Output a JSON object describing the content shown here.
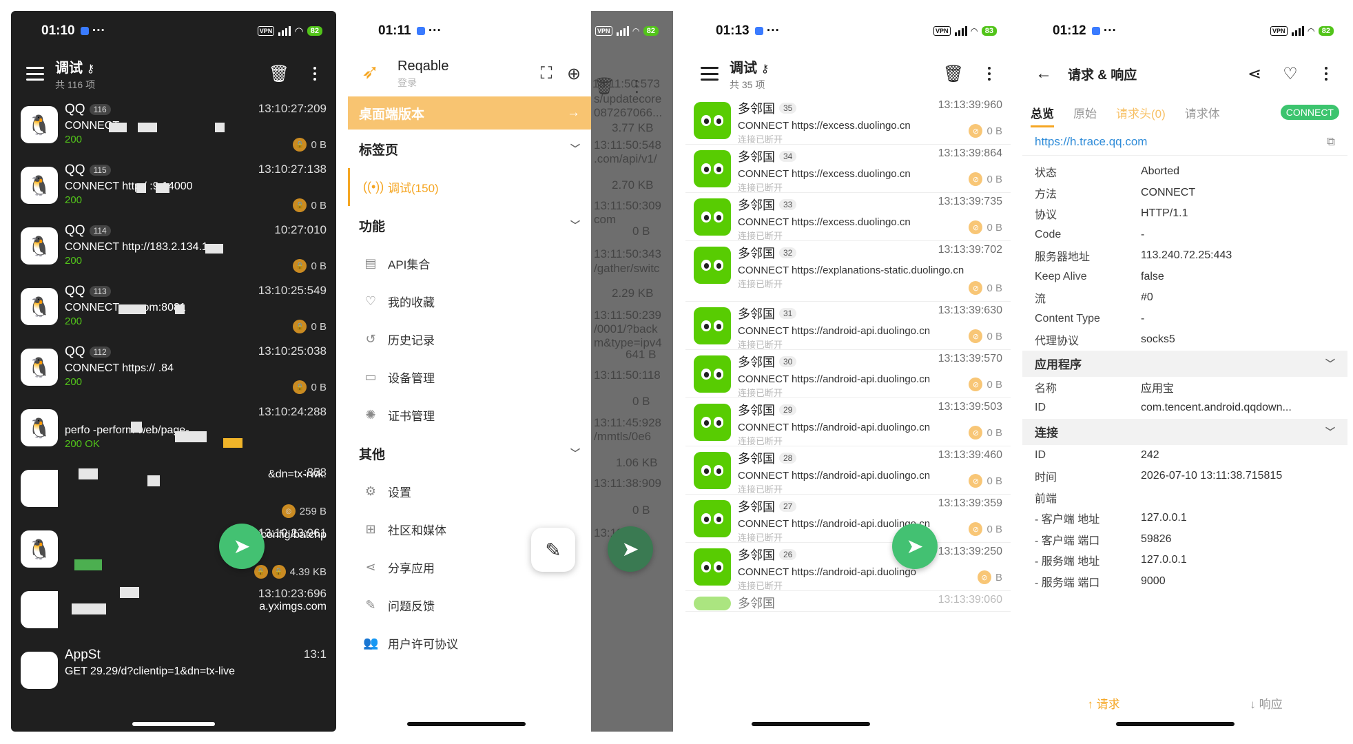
{
  "phone1": {
    "status_time": "01:10",
    "battery": "82",
    "title": "调试",
    "subtitle": "共 116 项",
    "rows": [
      {
        "name": "QQ",
        "badge": "116",
        "time": "13:10:27:209",
        "line": "CONNECT",
        "code": "200",
        "size": "0 B"
      },
      {
        "name": "QQ",
        "badge": "115",
        "time": "13:10:27:138",
        "line": "CONNECT http:/              :9:14000",
        "code": "200",
        "size": "0 B"
      },
      {
        "name": "QQ",
        "badge": "114",
        "time": "10:27:010",
        "line": "CONNECT http://183.2.134.1",
        "code": "200",
        "size": "0 B"
      },
      {
        "name": "QQ",
        "badge": "113",
        "time": "13:10:25:549",
        "line": "CONNECT               qq.com:8081",
        "code": "200",
        "size": "0 B"
      },
      {
        "name": "QQ",
        "badge": "112",
        "time": "13:10:25:038",
        "line": "CONNECT https://           .84",
        "code": "200",
        "size": "0 B"
      },
      {
        "name": "",
        "badge": "",
        "time": "13:10:24:288",
        "line": "perfo         -perform      web/page-",
        "code": "200 OK",
        "size": ""
      },
      {
        "name": "",
        "badge": "",
        "time": ":858",
        "line": "&dn=tx-rwk.",
        "code": "",
        "size": "259 B"
      },
      {
        "name": "",
        "badge": "",
        "time": "13:10:23:961",
        "line": "v3/config/batchp",
        "code": "",
        "size": "4.39 KB"
      },
      {
        "name": "",
        "badge": "",
        "time": "13:10:23:696",
        "line": "a.yximgs.com",
        "code": "",
        "size": ""
      },
      {
        "name": "AppSt",
        "badge": "",
        "time": "13:1",
        "line": "GET                29.29/d?clientip=1&dn=tx-live",
        "code": "",
        "size": ""
      }
    ]
  },
  "phone2": {
    "status_time": "01:11",
    "battery": "82",
    "app_name": "Reqable",
    "login": "登录",
    "desktop_banner": "桌面端版本",
    "sections": {
      "tabs": "标签页",
      "features": "功能",
      "other": "其他"
    },
    "active_tab": "调试(150)",
    "feature_items": [
      "API集合",
      "我的收藏",
      "历史记录",
      "设备管理",
      "证书管理"
    ],
    "other_items": [
      "设置",
      "社区和媒体",
      "分享应用",
      "问题反馈",
      "用户许可协议"
    ],
    "bg_lines": [
      "13:11:50:573",
      "s/updatecore",
      "087267066...",
      "3.77 KB",
      "13:11:50:548",
      ".com/api/v1/",
      "2.70 KB",
      "13:11:50:309",
      "com",
      "0 B",
      "13:11:50:343",
      "/gather/switc",
      "2.29 KB",
      "13:11:50:239",
      "/0001/?back",
      "m&type=ipv4",
      "641 B",
      "13:11:50:118",
      "0 B",
      "13:11:45:928",
      "/mmtls/0e6",
      "1.06 KB",
      "13:11:38:909",
      "0 B",
      "13:11"
    ]
  },
  "phone3": {
    "status_time": "01:13",
    "battery": "83",
    "title": "调试",
    "subtitle": "共 35 项",
    "rows": [
      {
        "name": "多邻国",
        "badge": "35",
        "time": "13:13:39:960",
        "line": "CONNECT https://excess.duolingo.cn",
        "sub": "连接已断开",
        "size": "0 B"
      },
      {
        "name": "多邻国",
        "badge": "34",
        "time": "13:13:39:864",
        "line": "CONNECT https://excess.duolingo.cn",
        "sub": "连接已断开",
        "size": "0 B"
      },
      {
        "name": "多邻国",
        "badge": "33",
        "time": "13:13:39:735",
        "line": "CONNECT https://excess.duolingo.cn",
        "sub": "连接已断开",
        "size": "0 B"
      },
      {
        "name": "多邻国",
        "badge": "32",
        "time": "13:13:39:702",
        "line": "CONNECT https://explanations-static.duolingo.cn",
        "sub": "连接已断开",
        "size": "0 B"
      },
      {
        "name": "多邻国",
        "badge": "31",
        "time": "13:13:39:630",
        "line": "CONNECT https://android-api.duolingo.cn",
        "sub": "连接已断开",
        "size": "0 B"
      },
      {
        "name": "多邻国",
        "badge": "30",
        "time": "13:13:39:570",
        "line": "CONNECT https://android-api.duolingo.cn",
        "sub": "连接已断开",
        "size": "0 B"
      },
      {
        "name": "多邻国",
        "badge": "29",
        "time": "13:13:39:503",
        "line": "CONNECT https://android-api.duolingo.cn",
        "sub": "连接已断开",
        "size": "0 B"
      },
      {
        "name": "多邻国",
        "badge": "28",
        "time": "13:13:39:460",
        "line": "CONNECT https://android-api.duolingo.cn",
        "sub": "连接已断开",
        "size": "0 B"
      },
      {
        "name": "多邻国",
        "badge": "27",
        "time": "13:13:39:359",
        "line": "CONNECT https://android-api.duolingo.cn",
        "sub": "连接已断开",
        "size": "0 B"
      },
      {
        "name": "多邻国",
        "badge": "26",
        "time": "13:13:39:250",
        "line": "CONNECT https://android-api.duolingo",
        "sub": "连接已断开",
        "size": "B"
      }
    ],
    "partial_row": {
      "name": "多邻国",
      "time": "13:13:39:060"
    }
  },
  "phone4": {
    "status_time": "01:12",
    "battery": "82",
    "title": "请求 & 响应",
    "tabs": [
      "总览",
      "原始",
      "请求头(0)",
      "请求体"
    ],
    "badge": "CONNECT",
    "url": "https://h.trace.qq.com",
    "overview": [
      {
        "k": "状态",
        "v": "Aborted"
      },
      {
        "k": "方法",
        "v": "CONNECT"
      },
      {
        "k": "协议",
        "v": "HTTP/1.1"
      },
      {
        "k": "Code",
        "v": "-"
      },
      {
        "k": "服务器地址",
        "v": "113.240.72.25:443"
      },
      {
        "k": "Keep Alive",
        "v": "false"
      },
      {
        "k": "流",
        "v": "#0"
      },
      {
        "k": "Content Type",
        "v": "-"
      },
      {
        "k": "代理协议",
        "v": "socks5"
      }
    ],
    "app_group": "应用程序",
    "app": [
      {
        "k": "名称",
        "v": "应用宝"
      },
      {
        "k": "ID",
        "v": "com.tencent.android.qqdown..."
      }
    ],
    "conn_group": "连接",
    "conn": [
      {
        "k": "ID",
        "v": "242"
      },
      {
        "k": "时间",
        "v": "2026-07-10 13:11:38.715815"
      },
      {
        "k": "前端",
        "v": ""
      },
      {
        "k": "- 客户端 地址",
        "v": "127.0.0.1"
      },
      {
        "k": "- 客户端 端口",
        "v": "59826"
      },
      {
        "k": "- 服务端 地址",
        "v": "127.0.0.1"
      },
      {
        "k": "- 服务端 端口",
        "v": "9000"
      }
    ],
    "bottom": {
      "request": "请求",
      "response": "响应"
    }
  }
}
